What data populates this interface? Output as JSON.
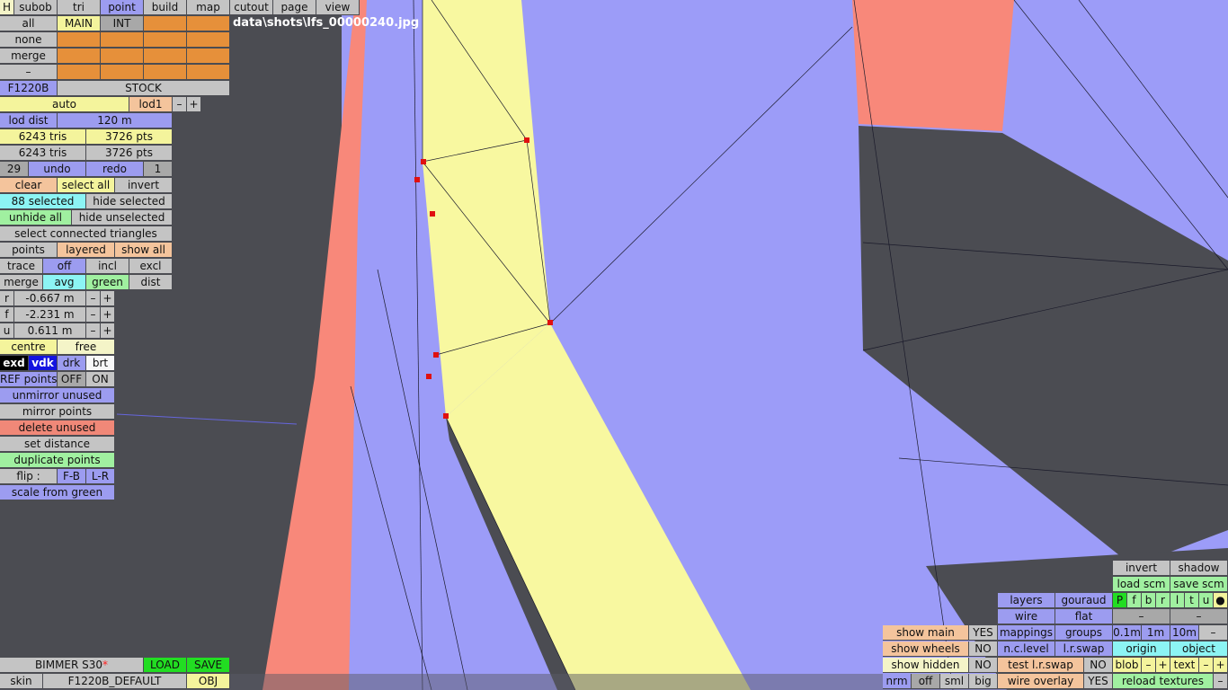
{
  "file_path": "data\\shots\\lfs_00000240.jpg",
  "tabs": [
    "H",
    "subob",
    "tri",
    "point",
    "build",
    "map",
    "cutout",
    "page",
    "view"
  ],
  "left": {
    "all": "all",
    "main": "MAIN",
    "int": "INT",
    "none": "none",
    "merge": "merge",
    "dash": "–",
    "car_code": "F1220B",
    "stock": "STOCK",
    "auto": "auto",
    "lod1": "lod1",
    "minus": "–",
    "plus": "+",
    "lod_dist": "lod dist",
    "lod_val": "120 m",
    "tris1": "6243 tris",
    "pts1": "3726 pts",
    "tris2": "6243 tris",
    "pts2": "3726 pts",
    "undo_count": "29",
    "undo": "undo",
    "redo": "redo",
    "redo_count": "1",
    "clear": "clear",
    "select_all": "select all",
    "invert": "invert",
    "selected": "88 selected",
    "hide_selected": "hide selected",
    "unhide_all": "unhide all",
    "hide_unselected": "hide unselected",
    "select_connected": "select connected triangles",
    "points": "points",
    "layered": "layered",
    "show_all": "show all",
    "trace": "trace",
    "off": "off",
    "incl": "incl",
    "excl": "excl",
    "merge2": "merge",
    "avg": "avg",
    "green": "green",
    "dist": "dist",
    "r": "r",
    "r_val": "-0.667 m",
    "f": "f",
    "f_val": "-2.231 m",
    "u": "u",
    "u_val": "0.611 m",
    "centre": "centre",
    "free": "free",
    "exd": "exd",
    "vdk": "vdk",
    "drk": "drk",
    "brt": "brt",
    "ref_points": "REF points",
    "ref_off": "OFF",
    "ref_on": "ON",
    "unmirror": "unmirror unused",
    "mirror": "mirror points",
    "delete_unused": "delete unused",
    "set_distance": "set distance",
    "duplicate": "duplicate points",
    "flip": "flip :",
    "fb": "F-B",
    "lr": "L-R",
    "scale_green": "scale from green"
  },
  "bottom_left": {
    "car_name": "BIMMER S30",
    "load": "LOAD",
    "save": "SAVE",
    "skin": "skin",
    "skin_name": "F1220B_DEFAULT",
    "obj": "OBJ"
  },
  "right": {
    "show_main": "show main",
    "yes1": "YES",
    "show_wheels": "show wheels",
    "no1": "NO",
    "show_hidden": "show hidden",
    "no2": "NO",
    "nrm": "nrm",
    "off": "off",
    "sml": "sml",
    "big": "big",
    "layers": "layers",
    "gouraud": "gouraud",
    "wire": "wire",
    "flat": "flat",
    "mappings": "mappings",
    "groups": "groups",
    "nc_level": "n.c.level",
    "lr_swap": "l.r.swap",
    "test_lr_swap": "test l.r.swap",
    "no3": "NO",
    "wire_overlay": "wire overlay",
    "yes2": "YES",
    "invert": "invert",
    "shadow": "shadow",
    "load_scm": "load scm",
    "save_scm": "save scm",
    "flags": [
      "P",
      "f",
      "b",
      "r",
      "l",
      "t",
      "u",
      "●"
    ],
    "dash1": "–",
    "dash2": "–",
    "d01": "0.1m",
    "d1": "1m",
    "d10": "10m",
    "dm": "–",
    "origin": "origin",
    "object": "object",
    "blob": "blob",
    "bm": "–",
    "bp": "+",
    "text": "text",
    "tm": "–",
    "tp": "+",
    "reload": "reload textures",
    "rm": "–"
  }
}
